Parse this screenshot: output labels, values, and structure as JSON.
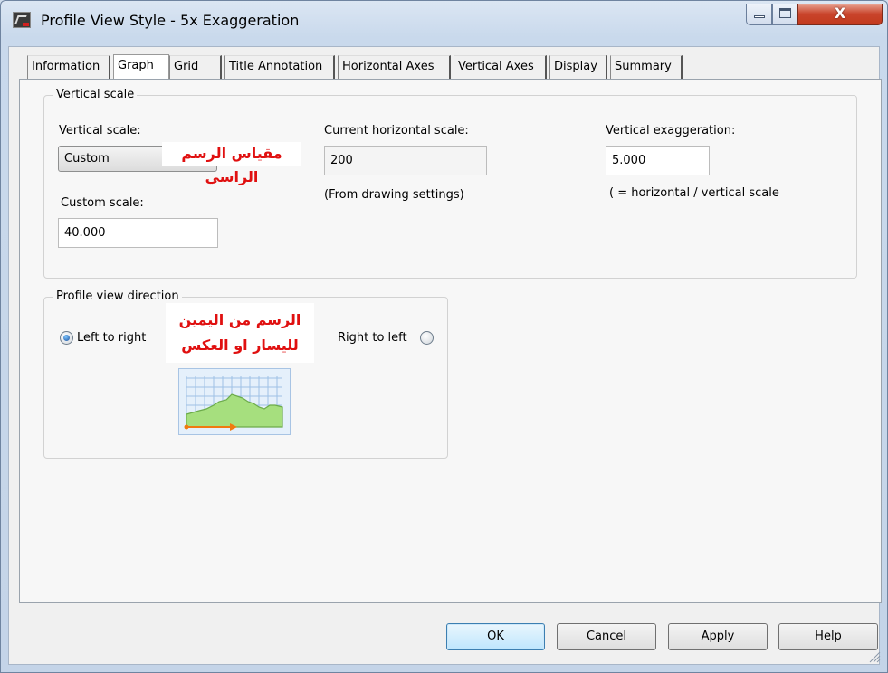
{
  "window": {
    "title": "Profile View Style - 5x Exaggeration"
  },
  "titlebar_buttons": {
    "minimize_icon": "minimize-icon",
    "maximize_icon": "maximize-icon",
    "close_label": "X"
  },
  "tabs": [
    {
      "label": "Information"
    },
    {
      "label": "Graph"
    },
    {
      "label": "Grid"
    },
    {
      "label": "Title Annotation"
    },
    {
      "label": "Horizontal Axes"
    },
    {
      "label": "Vertical Axes"
    },
    {
      "label": "Display"
    },
    {
      "label": "Summary"
    }
  ],
  "active_tab": "Graph",
  "vertical_scale_group": {
    "legend": "Vertical scale",
    "vertical_scale_label": "Vertical scale:",
    "vertical_scale_value": "Custom",
    "custom_scale_label": "Custom scale:",
    "custom_scale_value": "40.000",
    "current_horizontal_label": "Current horizontal scale:",
    "current_horizontal_value": "200",
    "from_drawing_note": "(From drawing settings)",
    "exaggeration_label": "Vertical exaggeration:",
    "exaggeration_value": "5.000",
    "exaggeration_note": "( = horizontal / vertical scale"
  },
  "direction_group": {
    "legend": "Profile view direction",
    "left_to_right_label": "Left to right",
    "right_to_left_label": "Right to left",
    "selected": "Left to right"
  },
  "annotations": {
    "vertical_scale_arabic": "مقياس الرسم الراسي",
    "direction_arabic_line1": "الرسم من اليمين",
    "direction_arabic_line2": "لليسار او العكس"
  },
  "footer": {
    "ok": "OK",
    "cancel": "Cancel",
    "apply": "Apply",
    "help": "Help"
  },
  "colors": {
    "annotation_text": "#e01010",
    "preview_fill": "#a6df7e",
    "preview_arrow": "#f07a10",
    "close_button": "#c9442b"
  }
}
